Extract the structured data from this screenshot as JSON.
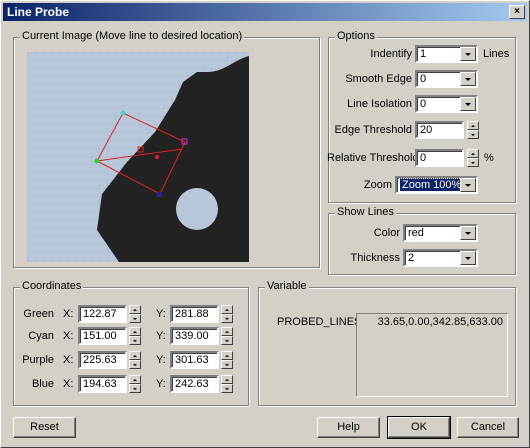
{
  "window": {
    "title": "Line Probe",
    "close_glyph": "×"
  },
  "image_group": {
    "title": "Current Image (Move line to desired location)",
    "probe_colors": {
      "green": "#33cc33",
      "cyan": "#55cccc",
      "purple": "#cc33cc",
      "blue": "#2222aa",
      "line": "#dd2222"
    }
  },
  "options": {
    "title": "Options",
    "identify": {
      "label": "Indentify",
      "value": "1",
      "suffix": "Lines"
    },
    "smooth_edge": {
      "label": "Smooth Edge",
      "value": "0"
    },
    "line_isolation": {
      "label": "Line Isolation",
      "value": "0"
    },
    "edge_threshold": {
      "label": "Edge Threshold",
      "value": "20"
    },
    "relative_threshold": {
      "label": "Relative Threshold",
      "value": "0",
      "suffix": "%"
    },
    "zoom": {
      "label": "Zoom",
      "value": "Zoom 100%"
    }
  },
  "show_lines": {
    "title": "Show Lines",
    "color": {
      "label": "Color",
      "value": "red"
    },
    "thickness": {
      "label": "Thickness",
      "value": "2"
    }
  },
  "coordinates": {
    "title": "Coordinates",
    "x_label": "X:",
    "y_label": "Y:",
    "rows": [
      {
        "name": "Green",
        "x": "122.87",
        "y": "281.88"
      },
      {
        "name": "Cyan",
        "x": "151.00",
        "y": "339.00"
      },
      {
        "name": "Purple",
        "x": "225.63",
        "y": "301.63"
      },
      {
        "name": "Blue",
        "x": "194.63",
        "y": "242.63"
      }
    ]
  },
  "variable": {
    "title": "Variable",
    "name": "PROBED_LINES",
    "value": "33.65,0.00,342.85,633.00"
  },
  "buttons": {
    "reset": "Reset",
    "help": "Help",
    "ok": "OK",
    "cancel": "Cancel"
  }
}
